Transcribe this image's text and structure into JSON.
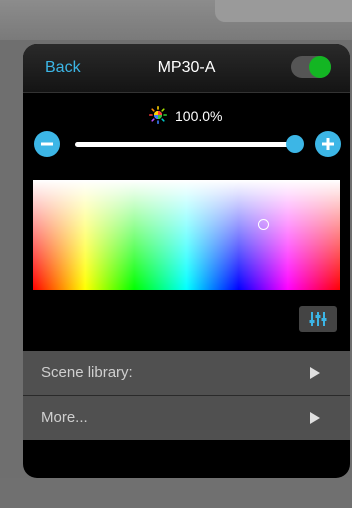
{
  "header": {
    "back_label": "Back",
    "title": "MP30-A",
    "power_on": true
  },
  "brightness": {
    "value_label": "100.0%",
    "level": 1.0
  },
  "color_picker": {
    "selection": {
      "hue_fraction": 0.75,
      "saturation_fraction": 0.4
    }
  },
  "menu": {
    "scene_library_label": "Scene library:",
    "more_label": "More..."
  },
  "colors": {
    "accent": "#3cb6e6",
    "toggle_on": "#13b623",
    "panel": "#000000",
    "menu_row": "#505050"
  },
  "icons": {
    "brightness": "sun-color-icon",
    "minus": "minus-icon",
    "plus": "plus-icon",
    "adjust": "sliders-icon",
    "chevron": "chevron-right-icon"
  }
}
